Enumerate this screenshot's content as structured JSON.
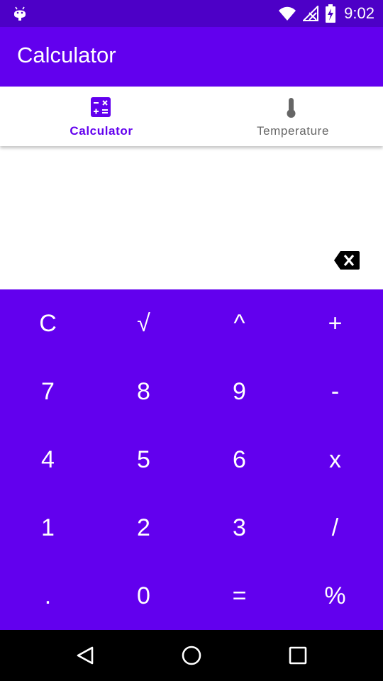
{
  "status_bar": {
    "time": "9:02",
    "icons": [
      "android-debug-icon",
      "wifi-icon",
      "no-signal-icon",
      "battery-charging-icon"
    ]
  },
  "app_bar": {
    "title": "Calculator"
  },
  "tabs": [
    {
      "label": "Calculator",
      "icon": "calculator-icon",
      "selected": true
    },
    {
      "label": "Temperature",
      "icon": "thermometer-icon",
      "selected": false
    }
  ],
  "display": {
    "expression": "",
    "backspace_icon": "backspace-icon"
  },
  "keypad": {
    "rows": [
      [
        "C",
        "√",
        "^",
        "+"
      ],
      [
        "7",
        "8",
        "9",
        "-"
      ],
      [
        "4",
        "5",
        "6",
        "x"
      ],
      [
        "1",
        "2",
        "3",
        "/"
      ],
      [
        ".",
        "0",
        "=",
        "%"
      ]
    ]
  },
  "nav_bar": {
    "buttons": [
      "back-icon",
      "home-icon",
      "recents-icon"
    ]
  },
  "colors": {
    "primary": "#6200ee",
    "primary_dark": "#4d00c7",
    "on_primary": "#ffffff",
    "tab_selected": "#6200ee",
    "tab_unselected": "#666666"
  }
}
